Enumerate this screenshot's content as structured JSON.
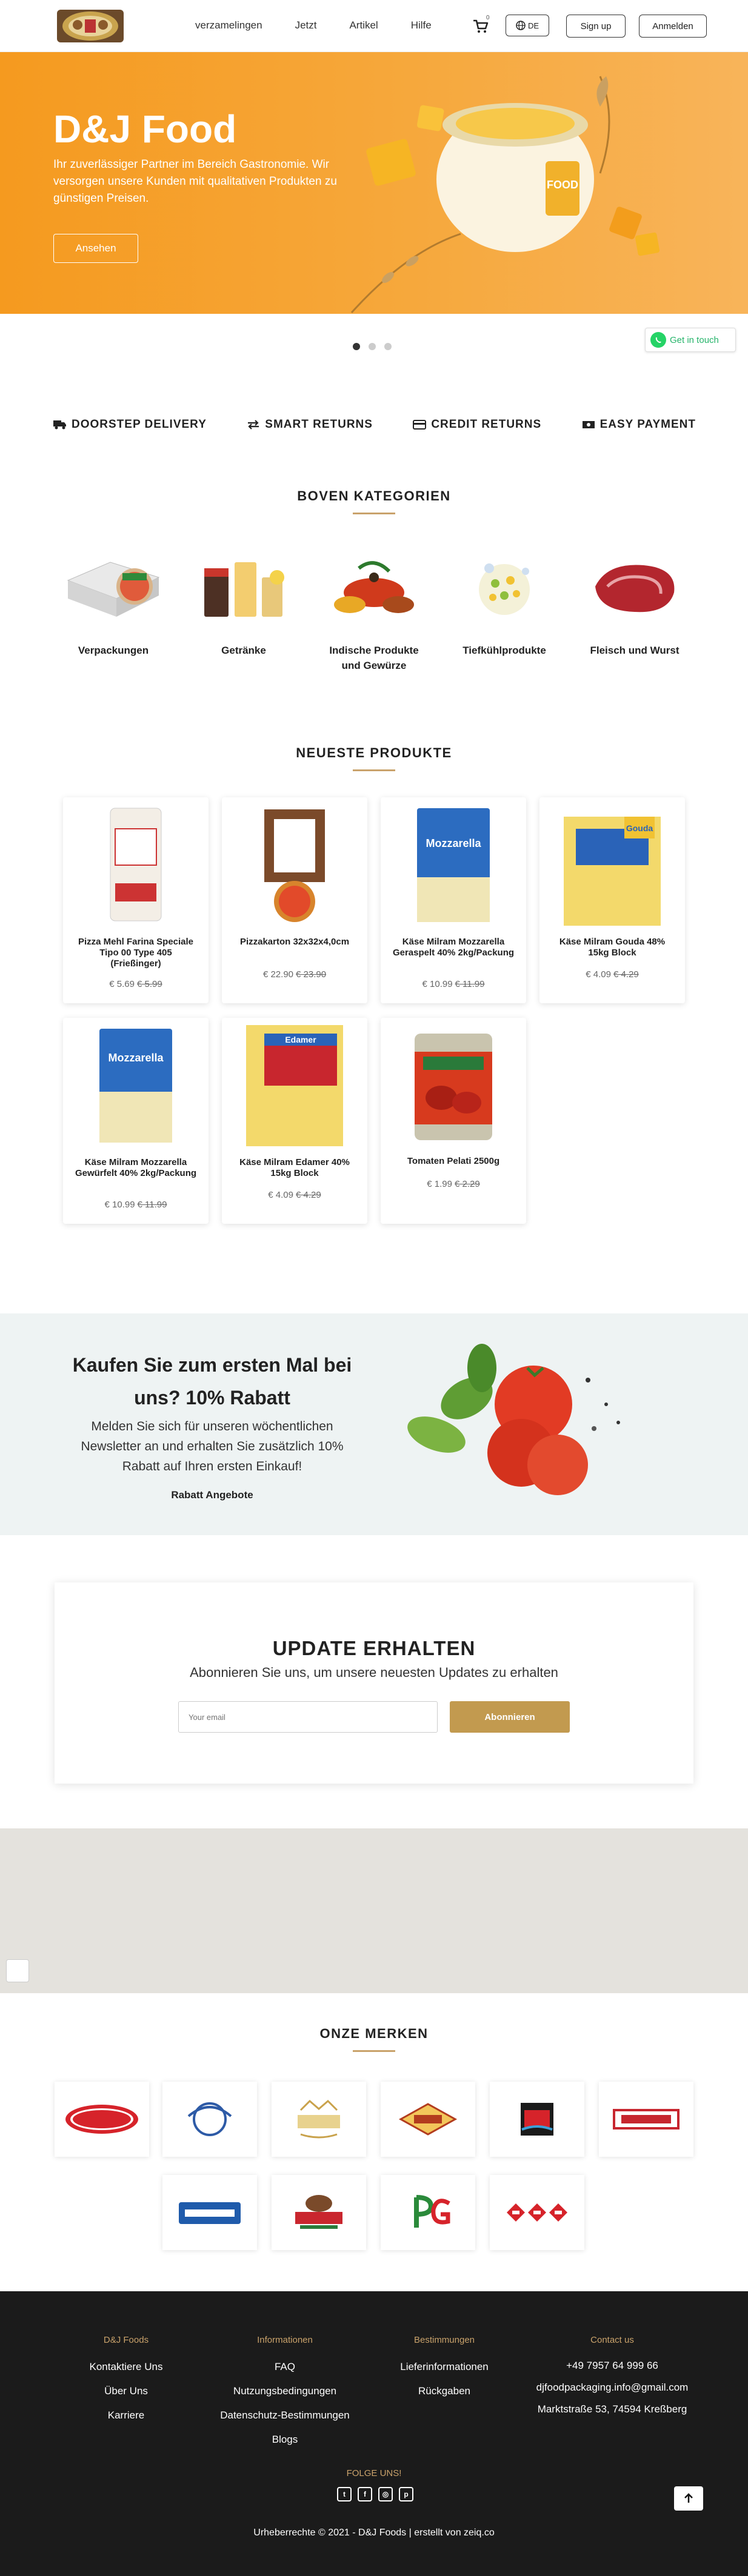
{
  "nav": {
    "links": [
      "verzamelingen",
      "Jetzt",
      "Artikel",
      "Hilfe"
    ],
    "cart_count": "0",
    "lang": "DE",
    "signup": "Sign up",
    "login": "Anmelden"
  },
  "hero": {
    "title": "D&J Food",
    "description": "Ihr zuverlässiger Partner im Bereich Gastronomie. Wir versorgen unsere Kunden mit qualitativen Produkten zu günstigen Preisen.",
    "button": "Ansehen",
    "slides": 3,
    "active_slide": 1
  },
  "contact_widget": {
    "label": "Get in touch"
  },
  "features": [
    {
      "icon": "truck-icon",
      "label": "DOORSTEP DELIVERY"
    },
    {
      "icon": "exchange-icon",
      "label": "SMART RETURNS"
    },
    {
      "icon": "credit-card-icon",
      "label": "CREDIT RETURNS"
    },
    {
      "icon": "money-icon",
      "label": "EASY PAYMENT"
    }
  ],
  "categories": {
    "title": "BOVEN KATEGORIEN",
    "items": [
      {
        "label": "Verpackungen"
      },
      {
        "label": "Getränke"
      },
      {
        "label": "Indische Produkte und Gewürze"
      },
      {
        "label": "Tiefkühlprodukte"
      },
      {
        "label": "Fleisch und Wurst"
      }
    ]
  },
  "products": {
    "title": "NEUESTE PRODUKTE",
    "items": [
      {
        "name": "Pizza Mehl Farina Speciale Tipo 00 Type 405 (Frießinger)",
        "price": "€ 5.69",
        "old_price": "€ 5.99"
      },
      {
        "name": "Pizzakarton 32x32x4,0cm",
        "price": "€ 22.90",
        "old_price": "€ 23.90"
      },
      {
        "name": "Käse Milram Mozzarella Geraspelt 40% 2kg/Packung",
        "price": "€ 10.99",
        "old_price": "€ 11.99"
      },
      {
        "name": "Käse Milram Gouda 48% 15kg Block",
        "price": "€ 4.09",
        "old_price": "€ 4.29"
      },
      {
        "name": "Käse Milram Mozzarella Gewürfelt 40% 2kg/Packung",
        "price": "€ 10.99",
        "old_price": "€ 11.99"
      },
      {
        "name": "Käse Milram Edamer 40% 15kg Block",
        "price": "€ 4.09",
        "old_price": "€ 4.29"
      },
      {
        "name": "Tomaten Pelati 2500g",
        "price": "€ 1.99",
        "old_price": "€ 2.29"
      }
    ]
  },
  "promo": {
    "title": "Kaufen Sie zum ersten Mal bei uns? 10% Rabatt",
    "text": "Melden Sie sich für unseren wöchentlichen Newsletter an und erhalten Sie zusätzlich 10% Rabatt auf Ihren ersten Einkauf!",
    "link": "Rabatt Angebote"
  },
  "newsletter": {
    "title": "UPDATE ERHALTEN",
    "subtitle": "Abonnieren Sie uns, um unsere neuesten Updates zu erhalten",
    "placeholder": "Your email",
    "button": "Abonnieren"
  },
  "brands": {
    "title": "ONZE MERKEN",
    "items": [
      "Barilla",
      "la Perla",
      "MIKADO",
      "PATAK'S",
      "TRS",
      "NAARMANN",
      "MILRAM",
      "DIVELLA",
      "PG",
      "MDH"
    ]
  },
  "footer": {
    "col1": {
      "head": "D&J Foods",
      "items": [
        "Kontaktiere Uns",
        "Über Uns",
        "Karriere"
      ]
    },
    "col2": {
      "head": "Informationen",
      "items": [
        "FAQ",
        "Nutzungsbedingungen",
        "Datenschutz-Bestimmungen",
        "Blogs"
      ]
    },
    "col3": {
      "head": "Bestimmungen",
      "items": [
        "Lieferinformationen",
        "Rückgaben"
      ]
    },
    "col4": {
      "head": "Contact us",
      "items": [
        "+49 7957 64 999 66",
        "djfoodpackaging.info@gmail.com",
        "Marktstraße 53, 74594 Kreßberg"
      ]
    },
    "follow": "FOLGE UNS!",
    "copyright": "Urheberrechte © 2021 - D&J Foods | erstellt von zeiq.co"
  }
}
